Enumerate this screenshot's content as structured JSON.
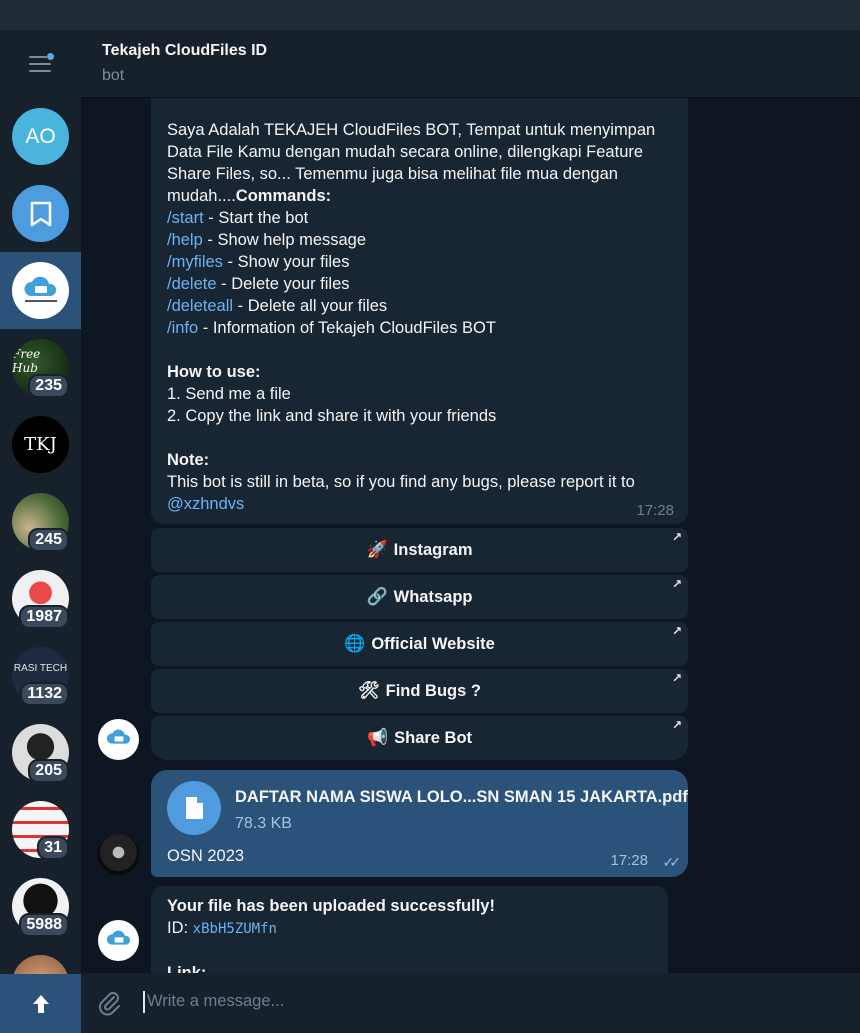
{
  "header": {
    "title": "Tekajeh CloudFiles ID",
    "subtitle": "bot"
  },
  "sidebar": {
    "chats": [
      {
        "name": "chat-ao",
        "avatar_text": "AO",
        "badge": ""
      },
      {
        "name": "chat-saved-messages",
        "avatar_text": "",
        "badge": ""
      },
      {
        "name": "chat-tekajeh-cloudfiles",
        "avatar_text": "",
        "badge": ""
      },
      {
        "name": "chat-freehub",
        "avatar_text": "Free Hub",
        "badge": "235"
      },
      {
        "name": "chat-tkj",
        "avatar_text": "TKJ",
        "badge": ""
      },
      {
        "name": "chat-6",
        "avatar_text": "",
        "badge": "245"
      },
      {
        "name": "chat-7",
        "avatar_text": "",
        "badge": "1987"
      },
      {
        "name": "chat-rasi-tech",
        "avatar_text": "RASI TECH",
        "badge": "1132"
      },
      {
        "name": "chat-9",
        "avatar_text": "",
        "badge": "205"
      },
      {
        "name": "chat-10",
        "avatar_text": "",
        "badge": "31"
      },
      {
        "name": "chat-11",
        "avatar_text": "",
        "badge": "5988"
      }
    ]
  },
  "message1": {
    "intro": "Saya Adalah TEKAJEH CloudFiles BOT, Tempat untuk menyimpan\nData File Kamu dengan mudah secara online, dilengkapi Feature\nShare Files, so... Temenmu juga bisa melihat file mua dengan\nmudah....",
    "commands_label": "Commands:",
    "commands": [
      {
        "cmd": "/start",
        "desc": " - Start the bot"
      },
      {
        "cmd": "/help",
        "desc": " - Show help message"
      },
      {
        "cmd": "/myfiles",
        "desc": " - Show your files"
      },
      {
        "cmd": "/delete",
        "desc": " - Delete your files"
      },
      {
        "cmd": "/deleteall",
        "desc": " - Delete all your files"
      },
      {
        "cmd": "/info",
        "desc": " - Information of Tekajeh CloudFiles BOT"
      }
    ],
    "howto_label": "How to use:",
    "howto_1": "1. Send me a file",
    "howto_2": "2. Copy the link and share it with your friends",
    "note_label": "Note:",
    "note_text": "This bot is still in beta, so if you find any bugs, please report it to",
    "mention": "@xzhndvs",
    "time": "17:28"
  },
  "keyboard": [
    {
      "emoji": "🚀",
      "label": "Instagram"
    },
    {
      "emoji": "🔗",
      "label": "Whatsapp"
    },
    {
      "emoji": "🌐",
      "label": "Official Website"
    },
    {
      "emoji": "🛠",
      "label": "Find Bugs ?"
    },
    {
      "emoji": "📢",
      "label": "Share Bot"
    }
  ],
  "file_message": {
    "filename": "DAFTAR NAMA SISWA LOLO...SN SMAN 15 JAKARTA.pdf",
    "size": "78.3 KB",
    "caption": "OSN 2023",
    "time": "17:28"
  },
  "message3": {
    "line1": "Your file has been uploaded successfully!",
    "id_label": "ID: ",
    "id_value": "xBbH5ZUMfn",
    "link_label": "Link:"
  },
  "composer": {
    "placeholder": "Write a message..."
  },
  "colors": {
    "accent": "#2b5278",
    "link": "#6ab3f3",
    "bubble": "#182533",
    "background": "#0e1621"
  }
}
